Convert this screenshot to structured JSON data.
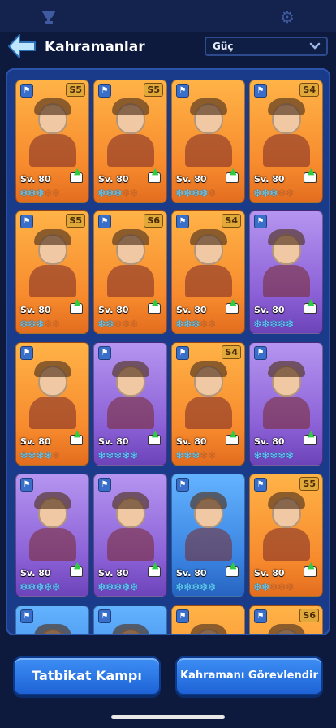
{
  "header": {
    "title": "Kahramanlar",
    "sort_value": "Güç"
  },
  "icons": {
    "top_left": "trophy-icon",
    "top_right": "gear-icon",
    "back": "back-arrow-icon",
    "sort_chevron": "chevron-down-icon"
  },
  "heroes": [
    {
      "level": "Sv. 80",
      "rank": "S5",
      "bg": "orange",
      "stars_on": 3,
      "stars_total": 5
    },
    {
      "level": "Sv. 80",
      "rank": "S5",
      "bg": "orange",
      "stars_on": 3,
      "stars_total": 5
    },
    {
      "level": "Sv. 80",
      "rank": "",
      "bg": "orange",
      "stars_on": 4,
      "stars_total": 5
    },
    {
      "level": "Sv. 80",
      "rank": "S4",
      "bg": "orange",
      "stars_on": 3,
      "stars_total": 5
    },
    {
      "level": "Sv. 80",
      "rank": "S5",
      "bg": "orange",
      "stars_on": 3,
      "stars_total": 5
    },
    {
      "level": "Sv. 80",
      "rank": "S6",
      "bg": "orange",
      "stars_on": 2,
      "stars_total": 5
    },
    {
      "level": "Sv. 80",
      "rank": "S4",
      "bg": "orange",
      "stars_on": 3,
      "stars_total": 5
    },
    {
      "level": "Sv. 80",
      "rank": "",
      "bg": "purple",
      "stars_on": 5,
      "stars_total": 5
    },
    {
      "level": "Sv. 80",
      "rank": "",
      "bg": "orange",
      "stars_on": 4,
      "stars_total": 5
    },
    {
      "level": "Sv. 80",
      "rank": "",
      "bg": "purple",
      "stars_on": 5,
      "stars_total": 5
    },
    {
      "level": "Sv. 80",
      "rank": "S4",
      "bg": "orange",
      "stars_on": 3,
      "stars_total": 5
    },
    {
      "level": "Sv. 80",
      "rank": "",
      "bg": "purple",
      "stars_on": 5,
      "stars_total": 5
    },
    {
      "level": "Sv. 80",
      "rank": "",
      "bg": "purple",
      "stars_on": 5,
      "stars_total": 5
    },
    {
      "level": "Sv. 80",
      "rank": "",
      "bg": "purple",
      "stars_on": 5,
      "stars_total": 5
    },
    {
      "level": "Sv. 80",
      "rank": "",
      "bg": "blue",
      "stars_on": 5,
      "stars_total": 5
    },
    {
      "level": "Sv. 80",
      "rank": "S5",
      "bg": "orange",
      "stars_on": 2,
      "stars_total": 5
    },
    {
      "level": "",
      "rank": "",
      "bg": "blue",
      "stars_on": 0,
      "stars_total": 0
    },
    {
      "level": "",
      "rank": "",
      "bg": "blue",
      "stars_on": 0,
      "stars_total": 0
    },
    {
      "level": "",
      "rank": "",
      "bg": "orange",
      "stars_on": 0,
      "stars_total": 0
    },
    {
      "level": "",
      "rank": "S6",
      "bg": "orange",
      "stars_on": 0,
      "stars_total": 0
    }
  ],
  "buttons": {
    "training_camp": "Tatbikat Kampı",
    "assign_hero": "Kahramanı Görevlendir"
  },
  "colors": {
    "accent": "#1e63d6",
    "star_on": "#63d3ff",
    "panel": "#1a3a8a"
  }
}
